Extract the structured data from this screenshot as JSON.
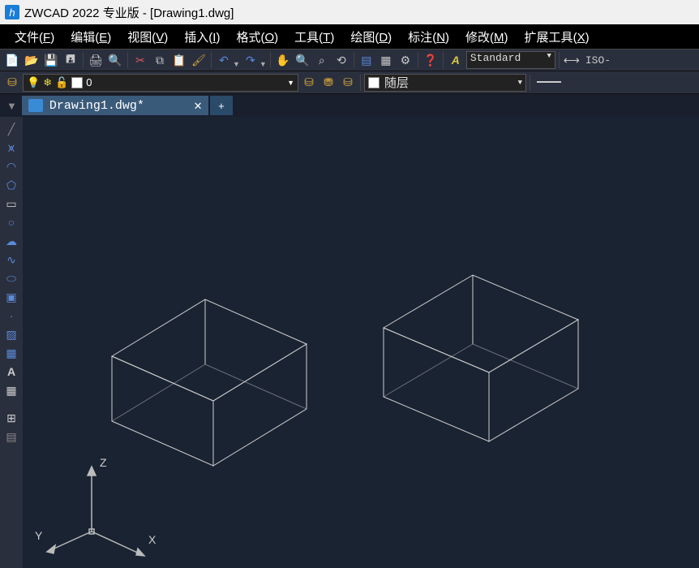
{
  "titlebar": {
    "app_icon_text": "h",
    "title": "ZWCAD 2022 专业版 - [Drawing1.dwg]"
  },
  "menubar": {
    "items": [
      {
        "label": "文件",
        "hotkey": "F"
      },
      {
        "label": "编辑",
        "hotkey": "E"
      },
      {
        "label": "视图",
        "hotkey": "V"
      },
      {
        "label": "插入",
        "hotkey": "I"
      },
      {
        "label": "格式",
        "hotkey": "O"
      },
      {
        "label": "工具",
        "hotkey": "T"
      },
      {
        "label": "绘图",
        "hotkey": "D"
      },
      {
        "label": "标注",
        "hotkey": "N"
      },
      {
        "label": "修改",
        "hotkey": "M"
      },
      {
        "label": "扩展工具",
        "hotkey": "X"
      }
    ]
  },
  "toolbar1": {
    "style_label": "Standard",
    "linetype_label": "ISO-"
  },
  "toolbar2": {
    "layer_name": "0",
    "bylayer_label": "随层"
  },
  "tabs": {
    "active_name": "Drawing1.dwg*",
    "close_glyph": "✕",
    "new_glyph": "+"
  },
  "gizmo": {
    "x": "X",
    "y": "Y",
    "z": "Z"
  },
  "icons": {
    "file_new": "📄",
    "folder": "📂",
    "save": "💾",
    "saveas": "🖪",
    "print": "🖨",
    "preview": "🔍",
    "cut": "✂",
    "copy": "⧉",
    "paste": "📋",
    "match": "🖌",
    "undo": "↶",
    "redo": "↷",
    "pan": "✋",
    "zoom_realtime": "🔍",
    "zoom_window": "⌕",
    "zoom_prev": "⟲",
    "props": "▤",
    "layers_panel": "▦",
    "qselect": "⚙",
    "help": "❓",
    "text_style": "A",
    "dim_style": "⟷",
    "layer_mgr": "⛁",
    "bulb": "💡",
    "freeze": "❄",
    "lock": "🔓",
    "layer_color": "◻",
    "layer_state1": "⛁",
    "layer_state2": "⛃",
    "layer_state3": "⛁",
    "line": "╱",
    "polyline": "⩙",
    "arc": "◠",
    "polygon": "⬠",
    "rectangle": "▭",
    "circle": "○",
    "revision_cloud": "☁",
    "spline": "∿",
    "ellipse": "⬭",
    "block": "▣",
    "point": "·",
    "hatch": "▨",
    "region": "▦",
    "text_tool": "A",
    "table": "▦",
    "grid_tool": "⊞",
    "sheet": "▤"
  }
}
